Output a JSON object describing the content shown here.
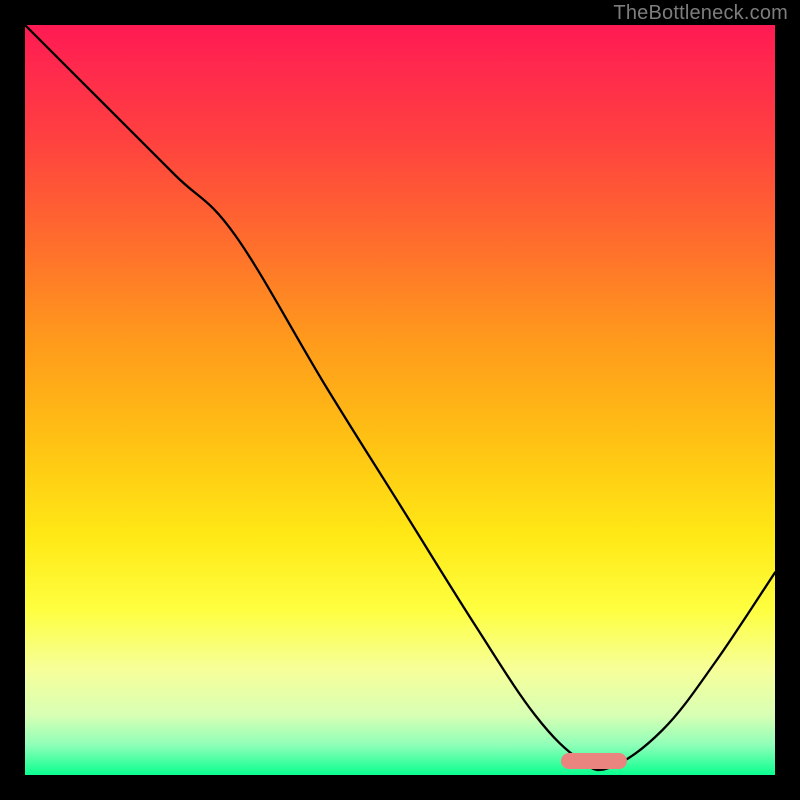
{
  "watermark": "TheBottleneck.com",
  "marker": {
    "color": "#e9857e",
    "left_pct": 71.5,
    "top_pct": 97.0,
    "width_pct": 8.8,
    "height_pct": 2.2
  },
  "chart_data": {
    "type": "line",
    "title": "",
    "xlabel": "",
    "ylabel": "",
    "xlim": [
      0,
      100
    ],
    "ylim": [
      0,
      100
    ],
    "grid": false,
    "legend": false,
    "annotations": [
      {
        "text": "TheBottleneck.com",
        "position": "top-right"
      }
    ],
    "series": [
      {
        "name": "bottleneck-curve",
        "x": [
          0,
          10,
          20,
          28,
          40,
          50,
          60,
          68,
          74,
          78,
          85,
          92,
          100
        ],
        "values": [
          100,
          90,
          80,
          72,
          52,
          36,
          20,
          8,
          2,
          1,
          6,
          15,
          27
        ]
      }
    ],
    "optimum_range_x": [
      71.5,
      80.3
    ]
  }
}
